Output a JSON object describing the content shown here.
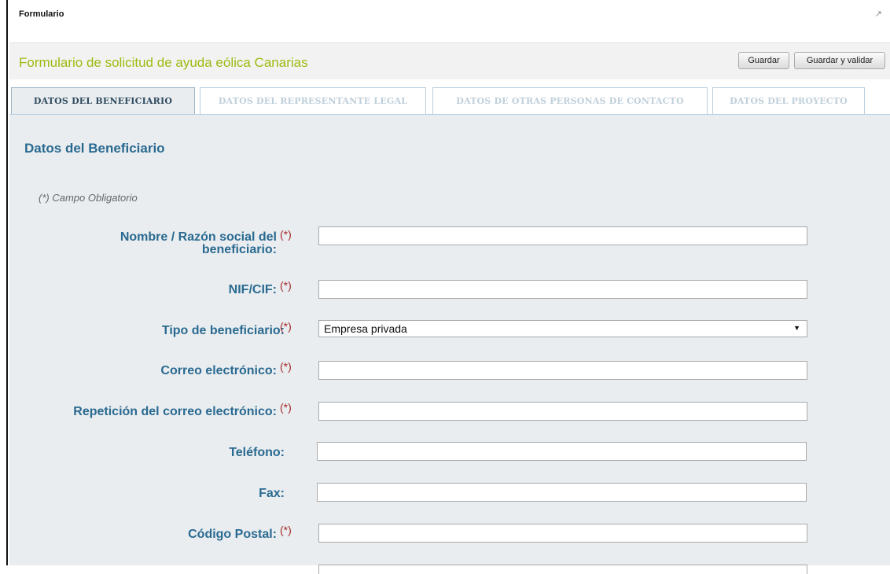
{
  "window": {
    "title": "Formulario",
    "popout_glyph": "↗"
  },
  "header": {
    "title": "Formulario de solicitud de ayuda eólica Canarias",
    "save_label": "Guardar",
    "save_validate_label": "Guardar y validar"
  },
  "tabs": [
    {
      "label": "DATOS DEL BENEFICIARIO"
    },
    {
      "label": "DATOS DEL REPRESENTANTE LEGAL"
    },
    {
      "label": "DATOS DE OTRAS PERSONAS DE CONTACTO"
    },
    {
      "label": "DATOS DEL PROYECTO"
    }
  ],
  "form": {
    "section_title": "Datos del Beneficiario",
    "required_note": "(*) Campo Obligatorio",
    "required_mark": "(*)",
    "fields": {
      "nombre": {
        "label_line1": "Nombre / Razón social del",
        "label_line2": "beneficiario:",
        "value": ""
      },
      "nif": {
        "label": "NIF/CIF:",
        "value": ""
      },
      "tipo": {
        "label": "Tipo de beneficiario:",
        "selected": "Empresa privada"
      },
      "correo": {
        "label": "Correo electrónico:",
        "value": ""
      },
      "correo_rep": {
        "label": "Repetición del correo electrónico:",
        "value": ""
      },
      "telefono": {
        "label": "Teléfono:",
        "value": ""
      },
      "fax": {
        "label": "Fax:",
        "value": ""
      },
      "cp": {
        "label": "Código Postal:",
        "value": ""
      }
    }
  },
  "colors": {
    "title_green": "#9bbb0e",
    "label_blue": "#2a6a90",
    "required_red": "#a52a2a",
    "panel_bg": "#e9edf0"
  }
}
